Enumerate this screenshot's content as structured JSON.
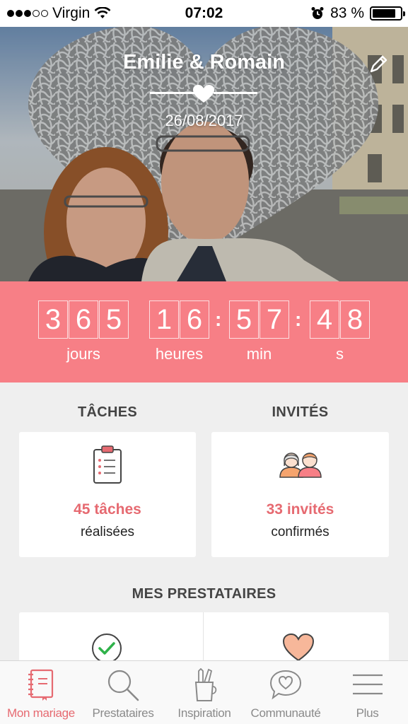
{
  "status_bar": {
    "carrier": "Virgin",
    "time": "07:02",
    "battery_percent": "83 %",
    "battery_level": 0.83
  },
  "hero": {
    "couple_names": "Emilie & Romain",
    "wedding_date": "26/08/2017"
  },
  "countdown": {
    "days": [
      "3",
      "6",
      "5"
    ],
    "hours": [
      "1",
      "6"
    ],
    "minutes": [
      "5",
      "7"
    ],
    "seconds": [
      "4",
      "8"
    ],
    "days_label": "jours",
    "hours_label": "heures",
    "minutes_label": "min",
    "seconds_label": "s"
  },
  "tasks": {
    "title": "TÂCHES",
    "count_text": "45 tâches",
    "sub_text": "réalisées"
  },
  "guests": {
    "title": "INVITÉS",
    "count_text": "33 invités",
    "sub_text": "confirmés"
  },
  "vendors": {
    "title": "MES PRESTATAIRES"
  },
  "tabbar": {
    "items": [
      {
        "label": "Mon mariage",
        "icon": "notebook-icon",
        "active": true
      },
      {
        "label": "Prestataires",
        "icon": "search-icon",
        "active": false
      },
      {
        "label": "Inspiration",
        "icon": "pencil-cup-icon",
        "active": false
      },
      {
        "label": "Communauté",
        "icon": "chat-heart-icon",
        "active": false
      },
      {
        "label": "Plus",
        "icon": "menu-icon",
        "active": false
      }
    ]
  },
  "colors": {
    "accent": "#f77f86",
    "accent_text": "#e66a71",
    "background": "#efefef"
  }
}
